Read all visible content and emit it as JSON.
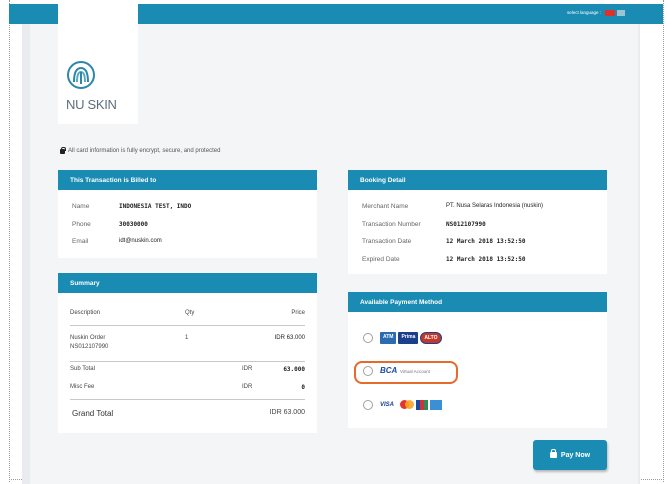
{
  "topbar": {
    "language_label": "select language :"
  },
  "brand": {
    "logo_text": "NU SKIN",
    "tagline": ""
  },
  "secure_notice": "All card information is fully encrypt, secure, and protected",
  "billed": {
    "title": "This Transaction is Billed to",
    "rows": [
      {
        "label": "Name",
        "value": "INDONESIA TEST, INDO"
      },
      {
        "label": "Phone",
        "value": "30030000"
      },
      {
        "label": "Email",
        "value": "idt@nuskin.com"
      }
    ]
  },
  "booking": {
    "title": "Booking Detail",
    "rows": [
      {
        "label": "Merchant Name",
        "value": "PT. Nusa Selaras Indonesia (nuskin)"
      },
      {
        "label": "Transaction Number",
        "value": "NS012107990"
      },
      {
        "label": "Transaction Date",
        "value": "12 March 2018 13:52:50"
      },
      {
        "label": "Expired Date",
        "value": "12 March 2018 13:52:50"
      }
    ]
  },
  "summary": {
    "title": "Summary",
    "headers": {
      "description": "Description",
      "qty": "Qty",
      "price": "Price"
    },
    "order_line1": "Nuskin Order",
    "order_line2": "NS012107990",
    "order_qty": "1",
    "order_price": "IDR 63.000",
    "subtotal_label": "Sub Total",
    "subtotal_currency": "IDR",
    "subtotal_value": "63.000",
    "misc_label": "Misc Fee",
    "misc_currency": "IDR",
    "misc_value": "0",
    "grand_label": "Grand Total",
    "grand_value": "IDR 63.000"
  },
  "payment": {
    "title": "Available Payment Method",
    "option1_logos": [
      "ATM",
      "Prima",
      "ALTO"
    ],
    "bca_label": "BCA",
    "bca_sub": "Virtual Account",
    "card_visa": "VISA"
  },
  "pay_button": "Pay Now",
  "colors": {
    "brand_blue": "#1a8cb4",
    "highlight_orange": "#e66a2c"
  },
  "icons": [
    "lock-icon",
    "shopping-bag-icon",
    "nuskin-logo-icon"
  ]
}
